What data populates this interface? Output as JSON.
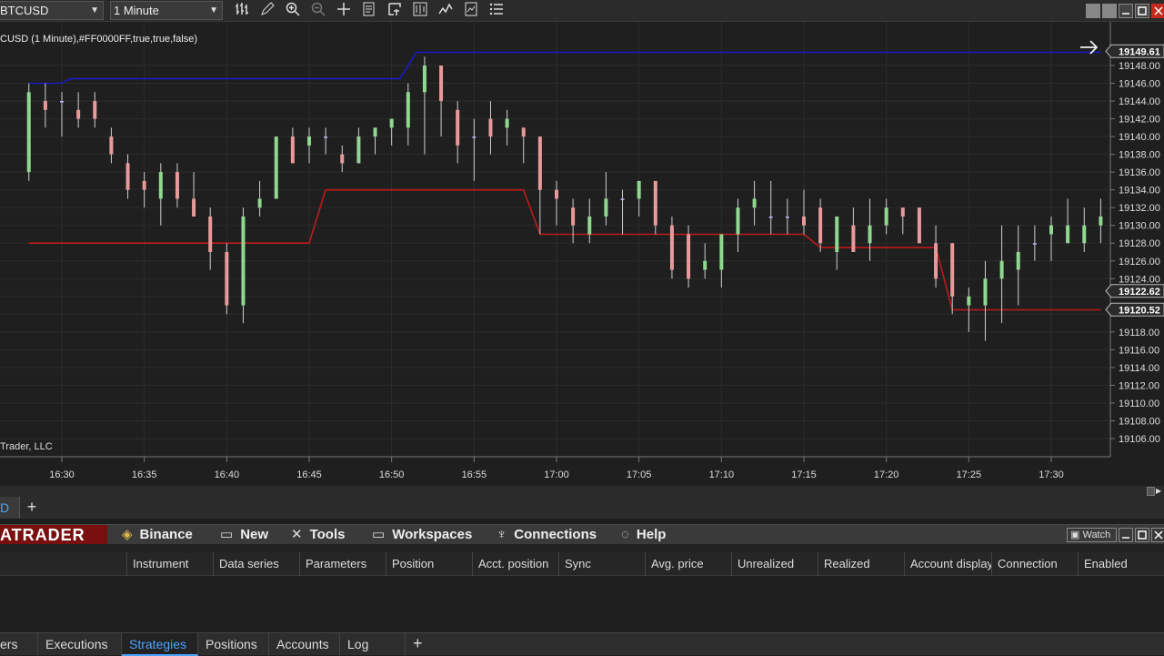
{
  "toolbar": {
    "instrument": "BTCUSD",
    "interval": "1 Minute"
  },
  "chart": {
    "indicator_label": "CUSD (1 Minute),#FF0000FF,true,true,false)",
    "copyright": "Trader, LLC",
    "price_ticks": [
      "19148.00",
      "19146.00",
      "19144.00",
      "19142.00",
      "19140.00",
      "19138.00",
      "19136.00",
      "19134.00",
      "19132.00",
      "19130.00",
      "19128.00",
      "19126.00",
      "19124.00",
      "19118.00",
      "19116.00",
      "19114.00",
      "19112.00",
      "19110.00",
      "19108.00",
      "19106.00"
    ],
    "price_tags": [
      {
        "value": "19149.61"
      },
      {
        "value": "19122.62"
      },
      {
        "value": "19120.52"
      }
    ],
    "time_ticks": [
      "16:30",
      "16:35",
      "16:40",
      "16:45",
      "16:50",
      "16:55",
      "17:00",
      "17:05",
      "17:10",
      "17:15",
      "17:20",
      "17:25",
      "17:30"
    ],
    "colors": {
      "up_candle": "#90d890",
      "down_candle": "#e89a9a",
      "neutral_candle": "#b8b8ff",
      "upper_line": "#1a1ac0",
      "lower_line": "#c01a1a",
      "grid": "#2c2c2c"
    }
  },
  "chart_data": {
    "type": "candlestick",
    "ylim": [
      19104,
      19151
    ],
    "x": [
      "16:28",
      "16:29",
      "16:30",
      "16:31",
      "16:32",
      "16:33",
      "16:34",
      "16:35",
      "16:36",
      "16:37",
      "16:38",
      "16:39",
      "16:40",
      "16:41",
      "16:42",
      "16:43",
      "16:44",
      "16:45",
      "16:46",
      "16:47",
      "16:48",
      "16:49",
      "16:50",
      "16:51",
      "16:52",
      "16:53",
      "16:54",
      "16:55",
      "16:56",
      "16:57",
      "16:58",
      "16:59",
      "17:00",
      "17:01",
      "17:02",
      "17:03",
      "17:04",
      "17:05",
      "17:06",
      "17:07",
      "17:08",
      "17:09",
      "17:10",
      "17:11",
      "17:12",
      "17:13",
      "17:14",
      "17:15",
      "17:16",
      "17:17",
      "17:18",
      "17:19",
      "17:20",
      "17:21",
      "17:22",
      "17:23",
      "17:24",
      "17:25",
      "17:26",
      "17:27",
      "17:28",
      "17:29",
      "17:30",
      "17:31",
      "17:32",
      "17:33"
    ],
    "candles": [
      {
        "o": 19136,
        "h": 19146,
        "l": 19135,
        "c": 19145
      },
      {
        "o": 19144,
        "h": 19146,
        "l": 19141,
        "c": 19143
      },
      {
        "o": 19144,
        "h": 19145,
        "l": 19140,
        "c": 19144
      },
      {
        "o": 19143,
        "h": 19145,
        "l": 19141,
        "c": 19142
      },
      {
        "o": 19144,
        "h": 19145,
        "l": 19141,
        "c": 19142
      },
      {
        "o": 19140,
        "h": 19141,
        "l": 19137,
        "c": 19138
      },
      {
        "o": 19137,
        "h": 19138,
        "l": 19133,
        "c": 19134
      },
      {
        "o": 19135,
        "h": 19136,
        "l": 19132,
        "c": 19134
      },
      {
        "o": 19133,
        "h": 19137,
        "l": 19130,
        "c": 19136
      },
      {
        "o": 19136,
        "h": 19137,
        "l": 19132,
        "c": 19133
      },
      {
        "o": 19133,
        "h": 19136,
        "l": 19131,
        "c": 19131
      },
      {
        "o": 19131,
        "h": 19132,
        "l": 19125,
        "c": 19127
      },
      {
        "o": 19127,
        "h": 19128,
        "l": 19120,
        "c": 19121
      },
      {
        "o": 19121,
        "h": 19132,
        "l": 19119,
        "c": 19131
      },
      {
        "o": 19132,
        "h": 19135,
        "l": 19131,
        "c": 19133
      },
      {
        "o": 19133,
        "h": 19140,
        "l": 19133,
        "c": 19140
      },
      {
        "o": 19140,
        "h": 19141,
        "l": 19137,
        "c": 19137
      },
      {
        "o": 19139,
        "h": 19141,
        "l": 19137,
        "c": 19140
      },
      {
        "o": 19140,
        "h": 19141,
        "l": 19138,
        "c": 19140
      },
      {
        "o": 19138,
        "h": 19139,
        "l": 19136,
        "c": 19137
      },
      {
        "o": 19137,
        "h": 19141,
        "l": 19137,
        "c": 19140
      },
      {
        "o": 19140,
        "h": 19141,
        "l": 19138,
        "c": 19141
      },
      {
        "o": 19141,
        "h": 19142,
        "l": 19139,
        "c": 19142
      },
      {
        "o": 19141,
        "h": 19146,
        "l": 19139,
        "c": 19145
      },
      {
        "o": 19145,
        "h": 19149,
        "l": 19138,
        "c": 19148
      },
      {
        "o": 19148,
        "h": 19148,
        "l": 19140,
        "c": 19144
      },
      {
        "o": 19143,
        "h": 19144,
        "l": 19137,
        "c": 19139
      },
      {
        "o": 19140,
        "h": 19142,
        "l": 19135,
        "c": 19140
      },
      {
        "o": 19142,
        "h": 19144,
        "l": 19138,
        "c": 19140
      },
      {
        "o": 19141,
        "h": 19143,
        "l": 19139,
        "c": 19142
      },
      {
        "o": 19141,
        "h": 19141,
        "l": 19137,
        "c": 19140
      },
      {
        "o": 19140,
        "h": 19140,
        "l": 19129,
        "c": 19134
      },
      {
        "o": 19134,
        "h": 19135,
        "l": 19130,
        "c": 19133
      },
      {
        "o": 19132,
        "h": 19133,
        "l": 19128,
        "c": 19130
      },
      {
        "o": 19129,
        "h": 19133,
        "l": 19128,
        "c": 19131
      },
      {
        "o": 19131,
        "h": 19136,
        "l": 19130,
        "c": 19133
      },
      {
        "o": 19133,
        "h": 19134,
        "l": 19129,
        "c": 19133
      },
      {
        "o": 19133,
        "h": 19135,
        "l": 19131,
        "c": 19135
      },
      {
        "o": 19135,
        "h": 19135,
        "l": 19129,
        "c": 19130
      },
      {
        "o": 19130,
        "h": 19131,
        "l": 19124,
        "c": 19125
      },
      {
        "o": 19129,
        "h": 19130,
        "l": 19123,
        "c": 19124
      },
      {
        "o": 19125,
        "h": 19128,
        "l": 19124,
        "c": 19126
      },
      {
        "o": 19125,
        "h": 19129,
        "l": 19123,
        "c": 19129
      },
      {
        "o": 19129,
        "h": 19133,
        "l": 19127,
        "c": 19132
      },
      {
        "o": 19132,
        "h": 19135,
        "l": 19130,
        "c": 19133
      },
      {
        "o": 19131,
        "h": 19135,
        "l": 19129,
        "c": 19131
      },
      {
        "o": 19131,
        "h": 19133,
        "l": 19129,
        "c": 19131
      },
      {
        "o": 19131,
        "h": 19134,
        "l": 19129,
        "c": 19130
      },
      {
        "o": 19132,
        "h": 19133,
        "l": 19127,
        "c": 19128
      },
      {
        "o": 19127,
        "h": 19131,
        "l": 19125,
        "c": 19131
      },
      {
        "o": 19130,
        "h": 19132,
        "l": 19127,
        "c": 19127
      },
      {
        "o": 19128,
        "h": 19133,
        "l": 19126,
        "c": 19130
      },
      {
        "o": 19130,
        "h": 19133,
        "l": 19129,
        "c": 19132
      },
      {
        "o": 19132,
        "h": 19132,
        "l": 19129,
        "c": 19131
      },
      {
        "o": 19132,
        "h": 19132,
        "l": 19128,
        "c": 19128
      },
      {
        "o": 19128,
        "h": 19130,
        "l": 19123,
        "c": 19124
      },
      {
        "o": 19128,
        "h": 19128,
        "l": 19120,
        "c": 19122
      },
      {
        "o": 19121,
        "h": 19123,
        "l": 19118,
        "c": 19122
      },
      {
        "o": 19121,
        "h": 19126,
        "l": 19117,
        "c": 19124
      },
      {
        "o": 19124,
        "h": 19130,
        "l": 19119,
        "c": 19126
      },
      {
        "o": 19125,
        "h": 19130,
        "l": 19121,
        "c": 19127
      },
      {
        "o": 19128,
        "h": 19130,
        "l": 19126,
        "c": 19128
      },
      {
        "o": 19129,
        "h": 19131,
        "l": 19126,
        "c": 19130
      },
      {
        "o": 19128,
        "h": 19133,
        "l": 19128,
        "c": 19130
      },
      {
        "o": 19128,
        "h": 19132,
        "l": 19127,
        "c": 19130
      },
      {
        "o": 19130,
        "h": 19133,
        "l": 19128,
        "c": 19131
      }
    ],
    "upper_line": [
      {
        "x": "16:28",
        "y": 19146
      },
      {
        "x": "16:30",
        "y": 19146
      },
      {
        "x": "16:30.5",
        "y": 19146.5
      },
      {
        "x": "16:50.5",
        "y": 19146.5
      },
      {
        "x": "16:51.5",
        "y": 19149.5
      },
      {
        "x": "17:33",
        "y": 19149.5
      }
    ],
    "lower_line": [
      {
        "x": "16:28",
        "y": 19128
      },
      {
        "x": "16:45",
        "y": 19128
      },
      {
        "x": "16:46",
        "y": 19134
      },
      {
        "x": "16:58",
        "y": 19134
      },
      {
        "x": "16:59",
        "y": 19129
      },
      {
        "x": "17:15",
        "y": 19129
      },
      {
        "x": "17:16",
        "y": 19127.5
      },
      {
        "x": "17:23",
        "y": 19127.5
      },
      {
        "x": "17:24",
        "y": 19120.5
      },
      {
        "x": "17:33",
        "y": 19120.5
      }
    ]
  },
  "tabs": {
    "current": "D",
    "add": "+"
  },
  "menu": {
    "brand": "ATRADER",
    "items": [
      "Binance",
      "New",
      "Tools",
      "Workspaces",
      "Connections",
      "Help"
    ],
    "watch": "Watch"
  },
  "grid": {
    "columns": [
      "Instrument",
      "Data series",
      "Parameters",
      "Position",
      "Acct. position",
      "Sync",
      "Avg. price",
      "Unrealized",
      "Realized",
      "Account display",
      "Connection",
      "Enabled"
    ]
  },
  "bottom_tabs": {
    "items": [
      "ers",
      "Executions",
      "Strategies",
      "Positions",
      "Accounts",
      "Log"
    ],
    "active": "Strategies",
    "add": "+"
  }
}
